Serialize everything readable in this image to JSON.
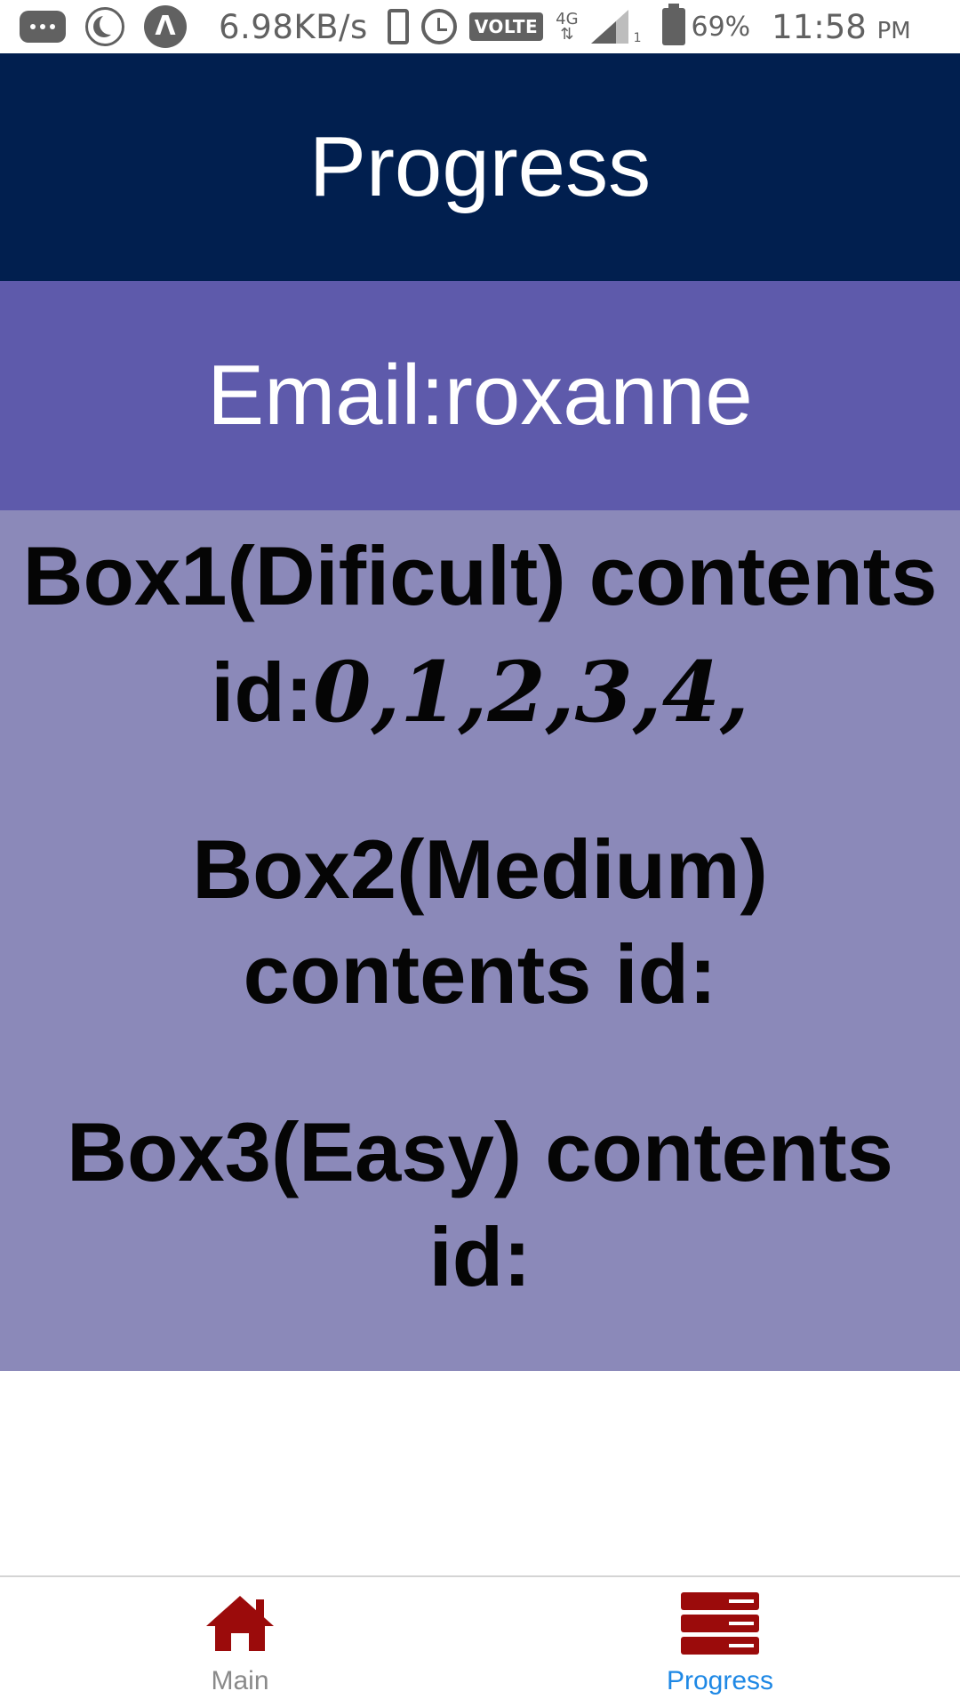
{
  "status_bar": {
    "net_speed": "6.98KB/s",
    "volte": "VOLTE",
    "network": "4G",
    "sim_slot": "1",
    "battery": "69%",
    "time": "11:58",
    "ampm": "PM",
    "icons": [
      "chat-icon",
      "moon-icon",
      "app-icon",
      "phone-icon",
      "alarm-icon",
      "signal-icon",
      "battery-icon"
    ]
  },
  "header": {
    "title": "Progress"
  },
  "user": {
    "email_line": "Email:roxanne"
  },
  "boxes": {
    "box1": {
      "line1": "Box1(Dificult) contents",
      "line2_prefix": "id:",
      "ids": "0,1,2,3,4,"
    },
    "box2": {
      "line1": "Box2(Medium)",
      "line2": "contents id:"
    },
    "box3": {
      "line1": "Box3(Easy) contents",
      "line2": "id:"
    }
  },
  "nav": {
    "items": [
      {
        "label": "Main",
        "icon": "home-icon",
        "active": false
      },
      {
        "label": "Progress",
        "icon": "list-icon",
        "active": true
      }
    ]
  },
  "colors": {
    "header_bg": "#011f4f",
    "email_bg": "#5e5aab",
    "boxes_bg": "#8b89b9",
    "nav_icon": "#9b0b0b",
    "nav_active_label": "#1e88e5"
  }
}
